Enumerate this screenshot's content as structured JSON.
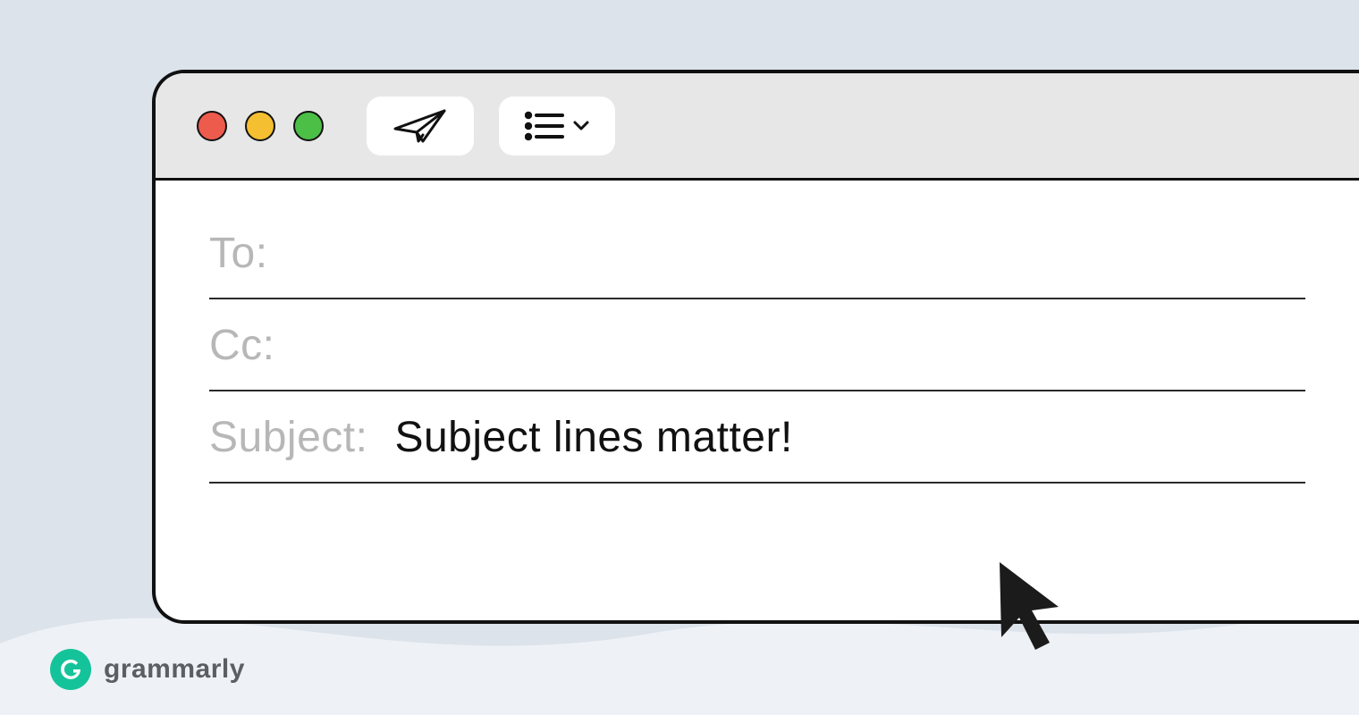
{
  "illustration": {
    "alt": "Email compose window illustration"
  },
  "window": {
    "traffic_lights": [
      "close",
      "minimize",
      "zoom"
    ],
    "toolbar": {
      "send_icon": "paper-plane-icon",
      "list_icon": "list-icon",
      "dropdown_icon": "chevron-down-icon"
    },
    "fields": {
      "to_label": "To:",
      "to_value": "",
      "cc_label": "Cc:",
      "cc_value": "",
      "subject_label": "Subject:",
      "subject_value": "Subject lines matter!"
    }
  },
  "cursor_icon": "cursor-icon",
  "brand": {
    "name": "grammarly",
    "logo_letter": "G",
    "accent": "#15c39a"
  },
  "colors": {
    "bg": "#dde3ea",
    "wave": "#eef2f6",
    "titlebar": "#e7e7e7",
    "label_gray": "#b7b7b7"
  }
}
